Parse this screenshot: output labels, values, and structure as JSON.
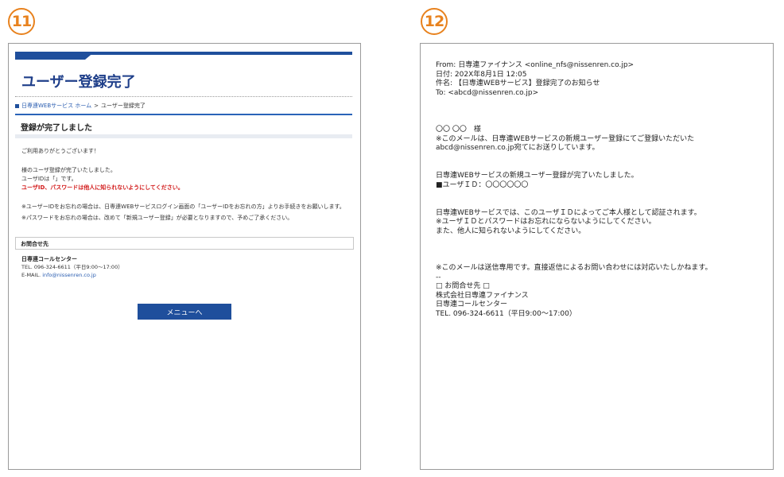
{
  "steps": {
    "left": "11",
    "right": "12"
  },
  "left": {
    "page_title": "ユーザー登録完了",
    "breadcrumb": {
      "home_link": "日専連WEBサービス ホーム",
      "separator": ">",
      "current": "ユーザー登録完了"
    },
    "section_title": "登録が完了しました",
    "thanks": "ご利用ありがとうございます！",
    "complete_msg": "様のユーザ登録が完了いたしました。",
    "user_id_line": "ユーザIDは「」です。",
    "warning": "ユーザID、パスワードは他人に知られないようにしてください。",
    "note1": "※ユーザーIDをお忘れの場合は、日専連WEBサービスログイン画面の「ユーザーIDをお忘れの方」よりお手続きをお願いします。",
    "note2": "※パスワードをお忘れの場合は、改めて「新規ユーザー登録」が必要となりますので、予めご了承ください。",
    "contact_heading": "お問合せ先",
    "contact_name": "日専連コールセンター",
    "contact_tel": "TEL. 096-324-6611（平日9:00～17:00）",
    "contact_email_label": "E-MAIL. ",
    "contact_email": "info@nissenren.co.jp",
    "menu_button": "メニューへ"
  },
  "right": {
    "from": "From: 日専連ファイナンス <online_nfs@nissenren.co.jp>",
    "date": "日付: 202X年8月1日 12:05",
    "subject": "件名: 【日専連WEBサービス】登録完了のお知らせ",
    "to": "To: <abcd@nissenren.co.jp>",
    "addressee": "〇〇 〇〇　様",
    "intro1": "※このメールは、日専連WEBサービスの新規ユーザー登録にてご登録いただいた",
    "intro2": "abcd@nissenren.co.jp宛てにお送りしています。",
    "done": "日専連WEBサービスの新規ユーザー登録が完了いたしました。",
    "userid": "■ユーザＩＤ：〇〇〇〇〇〇",
    "auth1": "日専連WEBサービスでは、このユーザＩＤによってご本人様として認証されます。",
    "auth2": "※ユーザＩＤとパスワードはお忘れにならないようにしてください。",
    "auth3": "また、他人に知られないようにしてください。",
    "sendonly": "※このメールは送信専用です。直接返信によるお問い合わせには対応いたしかねます。",
    "dashes": "--",
    "contact_head": "□ お問合せ先 □",
    "company": "株式会社日専連ファイナンス",
    "center": "日専連コールセンター",
    "tel": "TEL. 096-324-6611（平日9:00～17:00）"
  }
}
